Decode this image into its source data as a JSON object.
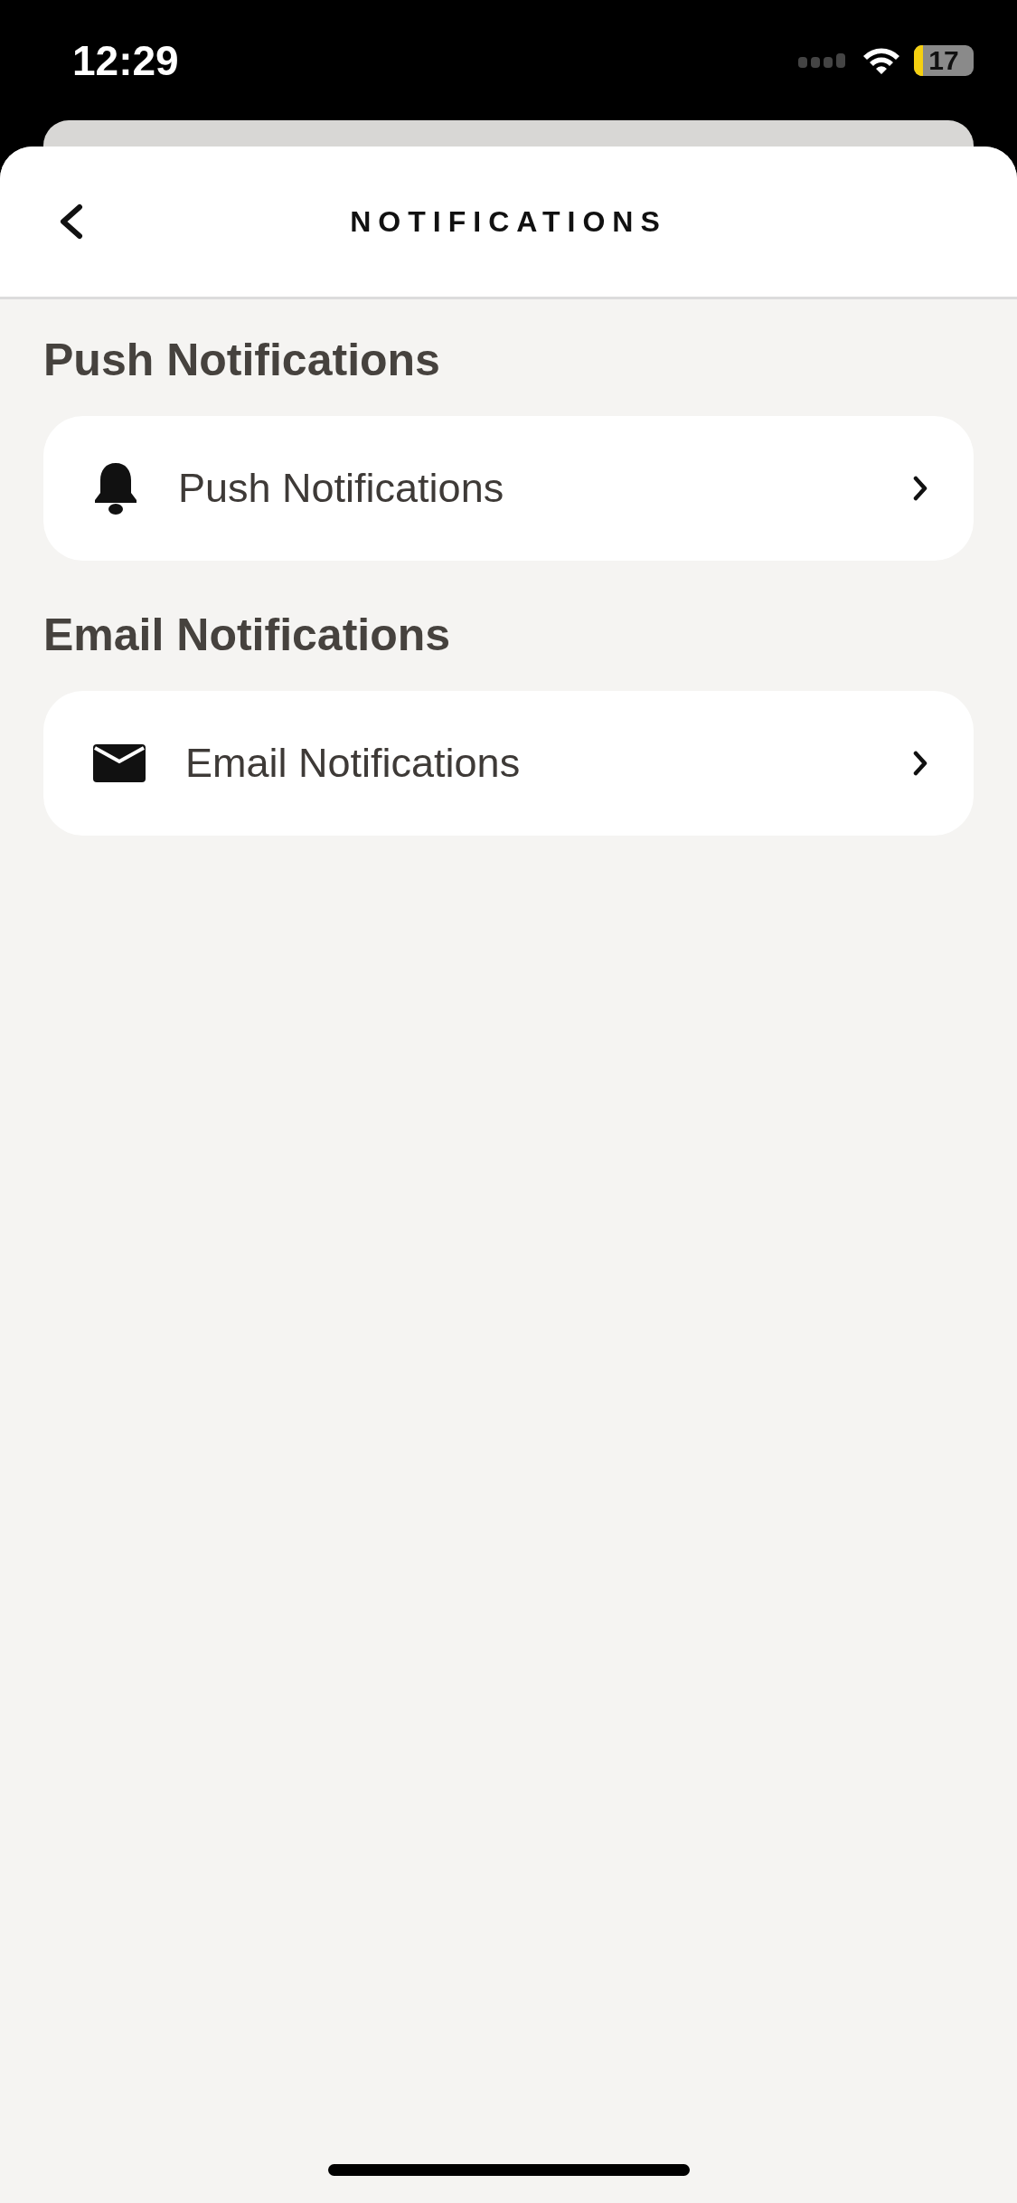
{
  "status_bar": {
    "time": "12:29",
    "battery": "17"
  },
  "header": {
    "title": "NOTIFICATIONS"
  },
  "sections": [
    {
      "title": "Push Notifications",
      "items": [
        {
          "kind": "bell",
          "label": "Push Notifications"
        }
      ]
    },
    {
      "title": "Email Notifications",
      "items": [
        {
          "kind": "envelope",
          "label": "Email Notifications"
        }
      ]
    }
  ]
}
